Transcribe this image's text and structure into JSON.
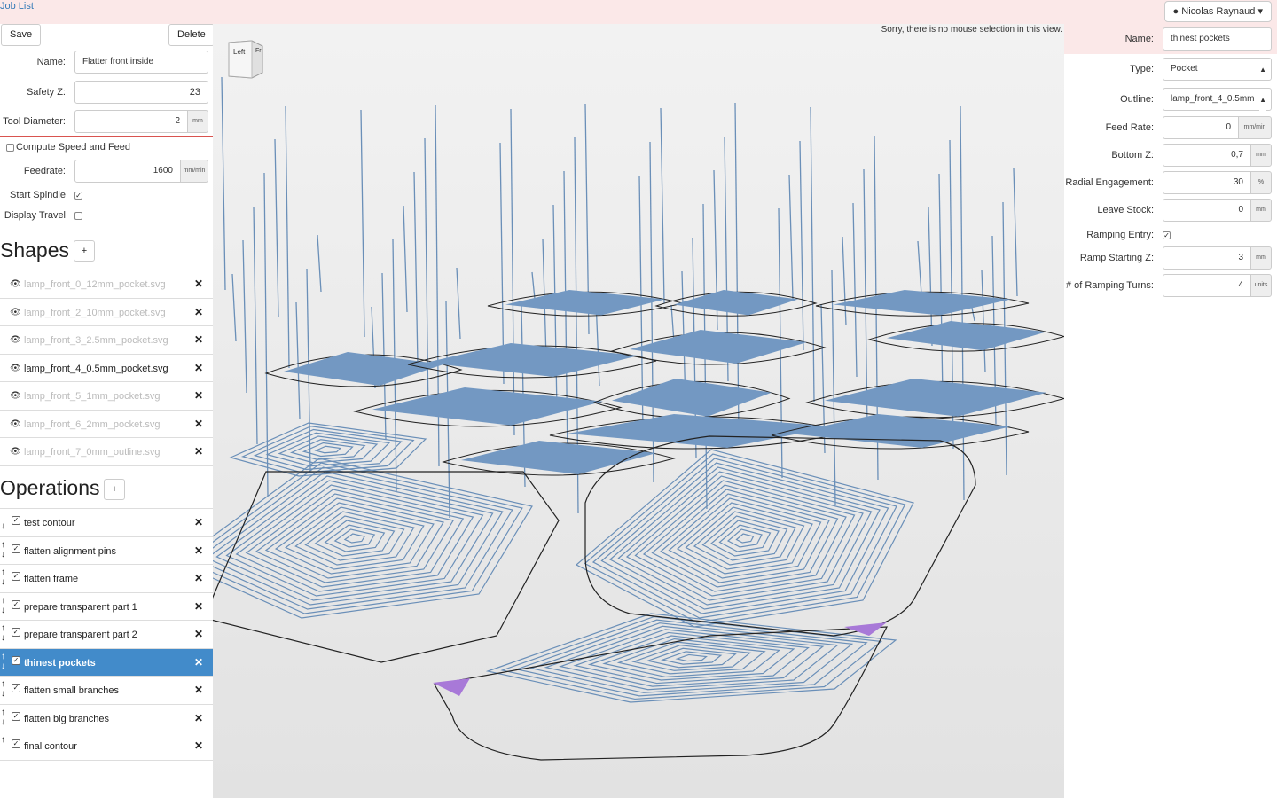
{
  "topbar": {
    "job_list": "Job List",
    "user": "Nicolas Raynaud"
  },
  "job": {
    "save": "Save",
    "delete": "Delete",
    "name_label": "Name:",
    "name_value": "Flatter front inside",
    "safety_label": "Safety Z:",
    "safety_value": "23",
    "tool_label": "Tool Diameter:",
    "tool_value": "2",
    "tool_unit": "mm",
    "compute_label": "Compute Speed and Feed",
    "feed_label": "Feedrate:",
    "feed_value": "1600",
    "feed_unit": "mm/min",
    "spindle_label": "Start Spindle",
    "travel_label": "Display Travel"
  },
  "shapes": {
    "title": "Shapes",
    "add": "+",
    "items": [
      {
        "name": "lamp_front_0_12mm_pocket.svg"
      },
      {
        "name": "lamp_front_2_10mm_pocket.svg"
      },
      {
        "name": "lamp_front_3_2.5mm_pocket.svg"
      },
      {
        "name": "lamp_front_4_0.5mm_pocket.svg"
      },
      {
        "name": "lamp_front_5_1mm_pocket.svg"
      },
      {
        "name": "lamp_front_6_2mm_pocket.svg"
      },
      {
        "name": "lamp_front_7_0mm_outline.svg"
      }
    ]
  },
  "operations": {
    "title": "Operations",
    "add": "+",
    "items": [
      {
        "name": "test contour"
      },
      {
        "name": "flatten alignment pins"
      },
      {
        "name": "flatten frame"
      },
      {
        "name": "prepare transparent part 1"
      },
      {
        "name": "prepare transparent part 2"
      },
      {
        "name": "thinest pockets"
      },
      {
        "name": "flatten small branches"
      },
      {
        "name": "flatten big branches"
      },
      {
        "name": "final contour"
      }
    ]
  },
  "view": {
    "message": "Sorry, there is no mouse selection in this view.",
    "cube_left": "Left",
    "cube_front": "Fr"
  },
  "op_form": {
    "name_label": "Name:",
    "name_value": "thinest pockets",
    "type_label": "Type:",
    "type_value": "Pocket",
    "outline_label": "Outline:",
    "outline_value": "lamp_front_4_0.5mm",
    "feed_label": "Feed Rate:",
    "feed_value": "0",
    "feed_unit": "mm/min",
    "bottom_label": "Bottom Z:",
    "bottom_value": "0,7",
    "bottom_unit": "mm",
    "radial_label": "Radial Engagement:",
    "radial_value": "30",
    "radial_unit": "%",
    "stock_label": "Leave Stock:",
    "stock_value": "0",
    "stock_unit": "mm",
    "ramp_label": "Ramping Entry:",
    "rampz_label": "Ramp Starting Z:",
    "rampz_value": "3",
    "rampz_unit": "mm",
    "turns_label": "# of Ramping Turns:",
    "turns_value": "4",
    "turns_unit": "units"
  },
  "colors": {
    "toolpath": "#6a8fb8",
    "fill": "#7398c2",
    "selected": "#428bca",
    "header_bg": "#fbe8e8",
    "purple": "#a879d8"
  }
}
